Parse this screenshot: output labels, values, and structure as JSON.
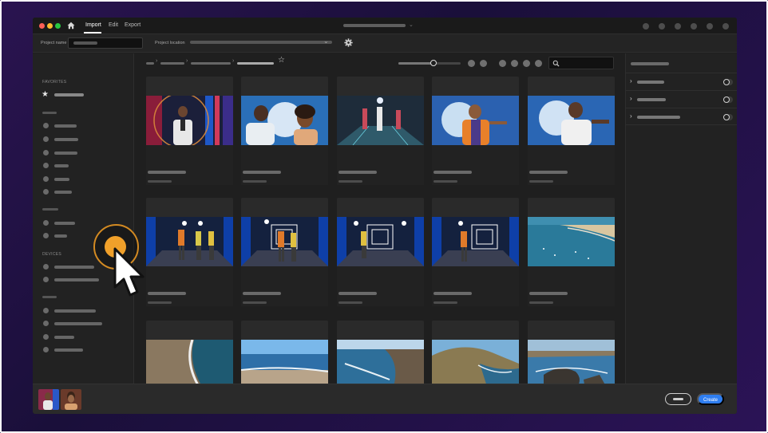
{
  "menu": {
    "tabs": [
      {
        "label": "Import",
        "active": true
      },
      {
        "label": "Edit",
        "active": false
      },
      {
        "label": "Export",
        "active": false
      }
    ]
  },
  "project": {
    "name_label": "Project name",
    "location_label": "Project location"
  },
  "sidebar": {
    "favorites_heading": "FAVORITES",
    "devices_heading": "DEVICES"
  },
  "bottom": {
    "create_label": "Create"
  },
  "colors": {
    "accent": "#2f7ef0",
    "cursor_highlight": "#f0a02a",
    "window_close": "#ff5f57",
    "window_minimize": "#febc2e",
    "window_zoom": "#28c840"
  },
  "icons": [
    "home-icon",
    "gear-icon",
    "star-icon",
    "search-icon",
    "chevron-right-icon",
    "toggle-icon",
    "cursor-arrow-icon"
  ]
}
